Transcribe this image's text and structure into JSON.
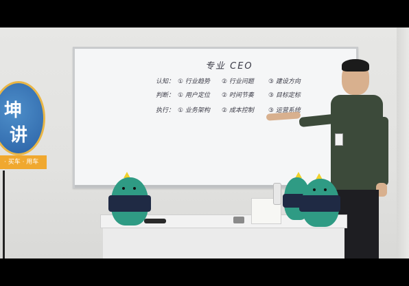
{
  "whiteboard": {
    "title": "专业 CEO",
    "rows": [
      {
        "label": "认知：",
        "items": [
          "① 行业趋势",
          "② 行业问题",
          "③ 建设方向"
        ]
      },
      {
        "label": "判断：",
        "items": [
          "① 用户定位",
          "② 时间节奏",
          "③ 目标定标"
        ]
      },
      {
        "label": "执行：",
        "items": [
          "① 业务架构",
          "② 成本控制",
          "③ 运营系统"
        ]
      }
    ]
  },
  "sign": {
    "glyph_top": "坤",
    "glyph_bottom": "讲",
    "bar_text": "· 买车 · 用车"
  },
  "colors": {
    "wall": "#e4e4e2",
    "board": "#f5f6f7",
    "mascot": "#2f9b84",
    "mascot_shirt": "#1f2a44",
    "shirt": "#3c4a3a",
    "sign_blue": "#2b62a6",
    "sign_orange": "#f0a82f"
  }
}
